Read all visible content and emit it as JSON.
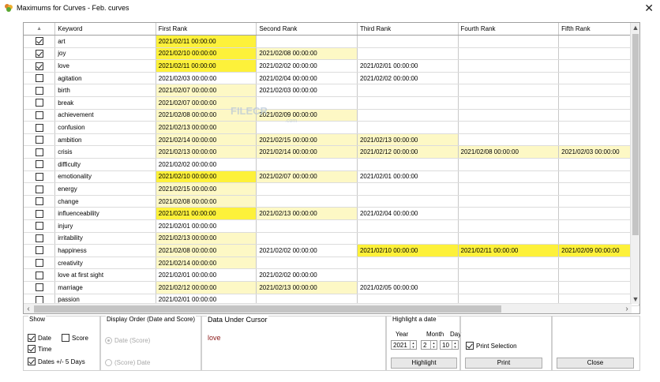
{
  "window": {
    "title": "Maximums for Curves - Feb. curves",
    "close_glyph": "✕",
    "app_icon": "leaf-icon"
  },
  "grid": {
    "columns": [
      "",
      "Keyword",
      "First Rank",
      "Second Rank",
      "Third Rank",
      "Fourth Rank",
      "Fifth Rank"
    ],
    "sort_indicator": "▲",
    "rows": [
      {
        "checked": true,
        "keyword": "art",
        "r1": "2021/02/11  00:00:00",
        "r2": "",
        "r3": "",
        "r4": "",
        "r5": ""
      },
      {
        "checked": true,
        "keyword": "joy",
        "r1": "2021/02/10  00:00:00",
        "r2": "2021/02/08  00:00:00",
        "r3": "",
        "r4": "",
        "r5": ""
      },
      {
        "checked": true,
        "keyword": "love",
        "r1": "2021/02/11  00:00:00",
        "r2": "2021/02/02  00:00:00",
        "r3": "2021/02/01  00:00:00",
        "r4": "",
        "r5": ""
      },
      {
        "checked": false,
        "keyword": "agitation",
        "r1": "2021/02/03  00:00:00",
        "r2": "2021/02/04  00:00:00",
        "r3": "2021/02/02  00:00:00",
        "r4": "",
        "r5": ""
      },
      {
        "checked": false,
        "keyword": "birth",
        "r1": "2021/02/07  00:00:00",
        "r2": "2021/02/03  00:00:00",
        "r3": "",
        "r4": "",
        "r5": ""
      },
      {
        "checked": false,
        "keyword": "break",
        "r1": "2021/02/07  00:00:00",
        "r2": "",
        "r3": "",
        "r4": "",
        "r5": ""
      },
      {
        "checked": false,
        "keyword": "achievement",
        "r1": "2021/02/08  00:00:00",
        "r2": "2021/02/09  00:00:00",
        "r3": "",
        "r4": "",
        "r5": ""
      },
      {
        "checked": false,
        "keyword": "confusion",
        "r1": "2021/02/13  00:00:00",
        "r2": "",
        "r3": "",
        "r4": "",
        "r5": ""
      },
      {
        "checked": false,
        "keyword": "ambition",
        "r1": "2021/02/14  00:00:00",
        "r2": "2021/02/15  00:00:00",
        "r3": "2021/02/13  00:00:00",
        "r4": "",
        "r5": ""
      },
      {
        "checked": false,
        "keyword": "crisis",
        "r1": "2021/02/13  00:00:00",
        "r2": "2021/02/14  00:00:00",
        "r3": "2021/02/12  00:00:00",
        "r4": "2021/02/08  00:00:00",
        "r5": "2021/02/03  00:00:00"
      },
      {
        "checked": false,
        "keyword": "difficulty",
        "r1": "2021/02/02  00:00:00",
        "r2": "",
        "r3": "",
        "r4": "",
        "r5": ""
      },
      {
        "checked": false,
        "keyword": "emotionality",
        "r1": "2021/02/10  00:00:00",
        "r2": "2021/02/07  00:00:00",
        "r3": "2021/02/01  00:00:00",
        "r4": "",
        "r5": ""
      },
      {
        "checked": false,
        "keyword": "energy",
        "r1": "2021/02/15  00:00:00",
        "r2": "",
        "r3": "",
        "r4": "",
        "r5": ""
      },
      {
        "checked": false,
        "keyword": "change",
        "r1": "2021/02/08  00:00:00",
        "r2": "",
        "r3": "",
        "r4": "",
        "r5": ""
      },
      {
        "checked": false,
        "keyword": "influenceability",
        "r1": "2021/02/11  00:00:00",
        "r2": "2021/02/13  00:00:00",
        "r3": "2021/02/04  00:00:00",
        "r4": "",
        "r5": ""
      },
      {
        "checked": false,
        "keyword": "injury",
        "r1": "2021/02/01  00:00:00",
        "r2": "",
        "r3": "",
        "r4": "",
        "r5": ""
      },
      {
        "checked": false,
        "keyword": "irritability",
        "r1": "2021/02/13  00:00:00",
        "r2": "",
        "r3": "",
        "r4": "",
        "r5": ""
      },
      {
        "checked": false,
        "keyword": "happiness",
        "r1": "2021/02/08  00:00:00",
        "r2": "2021/02/02  00:00:00",
        "r3": "2021/02/10  00:00:00",
        "r4": "2021/02/11  00:00:00",
        "r5": "2021/02/09  00:00:00"
      },
      {
        "checked": false,
        "keyword": "creativity",
        "r1": "2021/02/14  00:00:00",
        "r2": "",
        "r3": "",
        "r4": "",
        "r5": ""
      },
      {
        "checked": false,
        "keyword": "love at first sight",
        "r1": "2021/02/01  00:00:00",
        "r2": "2021/02/02  00:00:00",
        "r3": "",
        "r4": "",
        "r5": ""
      },
      {
        "checked": false,
        "keyword": "marriage",
        "r1": "2021/02/12  00:00:00",
        "r2": "2021/02/13  00:00:00",
        "r3": "2021/02/05  00:00:00",
        "r4": "",
        "r5": ""
      },
      {
        "checked": false,
        "keyword": "passion",
        "r1": "2021/02/01  00:00:00",
        "r2": "",
        "r3": "",
        "r4": "",
        "r5": ""
      }
    ],
    "highlight": {
      "strong_color": "#fdf13a",
      "light_color": "#fdf8c5"
    },
    "watermark": {
      "text": "FILECR",
      "sub": ".com"
    }
  },
  "show": {
    "label": "Show",
    "date": {
      "label": "Date",
      "checked": true
    },
    "score": {
      "label": "Score",
      "checked": false
    },
    "time": {
      "label": "Time",
      "checked": true
    },
    "dates_pm5": {
      "label": "Dates +/- 5 Days",
      "checked": true
    }
  },
  "display_order": {
    "label": "Display Order (Date and Score)",
    "opt1": {
      "label": "Date (Score)",
      "selected": true
    },
    "opt2": {
      "label": "(Score) Date",
      "selected": false
    }
  },
  "data_under_cursor": {
    "label": "Data Under Cursor",
    "value": "love"
  },
  "highlight_date": {
    "label": "Highlight a date",
    "year_label": "Year",
    "month_label": "Month",
    "day_label": "Day",
    "year": "2021",
    "month": "2",
    "day": "10",
    "button": "Highlight"
  },
  "print": {
    "selection_label": "Print Selection",
    "selection_checked": true,
    "button": "Print"
  },
  "close": {
    "button": "Close"
  }
}
